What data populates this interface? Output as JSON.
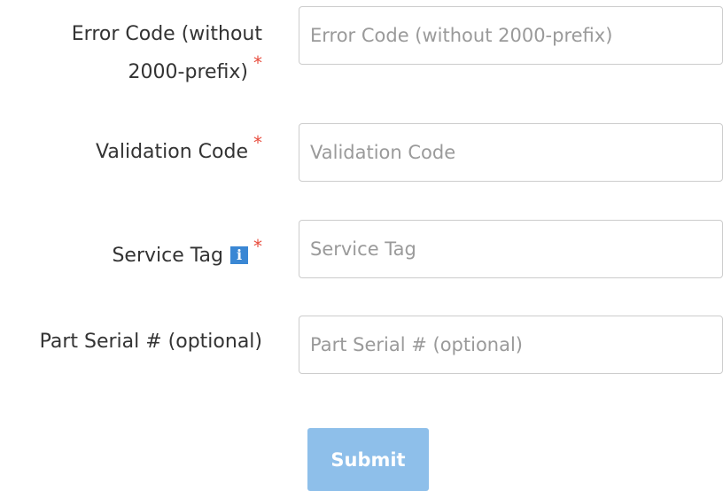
{
  "form": {
    "error_code": {
      "label_line1": "Error Code (without",
      "label_line2": "2000-prefix)",
      "required_mark": "*",
      "placeholder": "Error Code (without 2000-prefix)",
      "value": ""
    },
    "validation_code": {
      "label": "Validation Code",
      "required_mark": "*",
      "placeholder": "Validation Code",
      "value": ""
    },
    "service_tag": {
      "label": "Service Tag",
      "info_icon_glyph": "i",
      "required_mark": "*",
      "placeholder": "Service Tag",
      "value": ""
    },
    "part_serial": {
      "label": "Part Serial # (optional)",
      "placeholder": "Part Serial # (optional)",
      "value": ""
    },
    "submit_label": "Submit"
  },
  "colors": {
    "required": "#e84c3d",
    "info_icon": "#3a87d4",
    "submit_bg": "#8ebfea",
    "placeholder": "#9a9a9a",
    "border": "#cccccc"
  }
}
